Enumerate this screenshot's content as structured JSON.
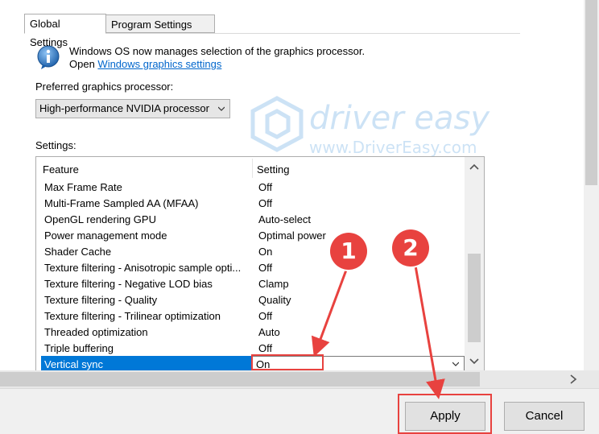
{
  "tabs": [
    {
      "label": "Global Settings",
      "active": true
    },
    {
      "label": "Program Settings",
      "active": false
    }
  ],
  "info": {
    "line1": "Windows OS now manages selection of the graphics processor.",
    "open_prefix": "Open ",
    "link": "Windows graphics settings"
  },
  "preferred": {
    "label": "Preferred graphics processor:",
    "value": "High-performance NVIDIA processor"
  },
  "watermark": {
    "brand": "driver easy",
    "url": "www.DriverEasy.com"
  },
  "settings": {
    "label": "Settings:",
    "columns": [
      "Feature",
      "Setting"
    ],
    "rows": [
      {
        "feature": "Max Frame Rate",
        "value": "Off"
      },
      {
        "feature": "Multi-Frame Sampled AA (MFAA)",
        "value": "Off"
      },
      {
        "feature": "OpenGL rendering GPU",
        "value": "Auto-select"
      },
      {
        "feature": "Power management mode",
        "value": "Optimal power"
      },
      {
        "feature": "Shader Cache",
        "value": "On"
      },
      {
        "feature": "Texture filtering - Anisotropic sample opti...",
        "value": "Off"
      },
      {
        "feature": "Texture filtering - Negative LOD bias",
        "value": "Clamp"
      },
      {
        "feature": "Texture filtering - Quality",
        "value": "Quality"
      },
      {
        "feature": "Texture filtering - Trilinear optimization",
        "value": "Off"
      },
      {
        "feature": "Threaded optimization",
        "value": "Auto"
      },
      {
        "feature": "Triple buffering",
        "value": "Off"
      }
    ],
    "selected_row": {
      "feature": "Vertical sync",
      "value": "On"
    }
  },
  "buttons": {
    "apply": "Apply",
    "cancel": "Cancel"
  },
  "annotations": {
    "step1": "1",
    "step2": "2"
  },
  "colors": {
    "selection": "#0078d7",
    "annotation": "#e8423f",
    "link": "#0066cc"
  }
}
